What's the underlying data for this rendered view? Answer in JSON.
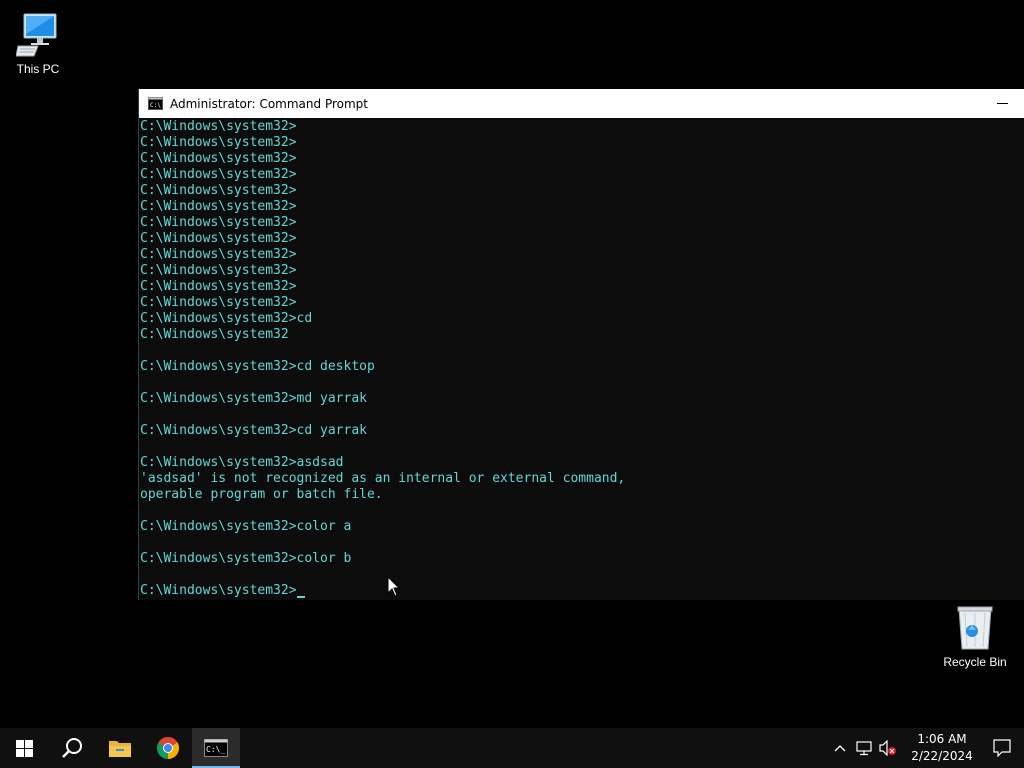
{
  "desktop": {
    "icons": [
      {
        "label": "This PC"
      },
      {
        "label": "Recycle Bin"
      }
    ]
  },
  "window": {
    "title": "Administrator: Command Prompt",
    "minimize_glyph": "—",
    "console_lines": [
      "C:\\Windows\\system32>",
      "C:\\Windows\\system32>",
      "C:\\Windows\\system32>",
      "C:\\Windows\\system32>",
      "C:\\Windows\\system32>",
      "C:\\Windows\\system32>",
      "C:\\Windows\\system32>",
      "C:\\Windows\\system32>",
      "C:\\Windows\\system32>",
      "C:\\Windows\\system32>",
      "C:\\Windows\\system32>",
      "C:\\Windows\\system32>",
      "C:\\Windows\\system32>cd",
      "C:\\Windows\\system32",
      "",
      "C:\\Windows\\system32>cd desktop",
      "",
      "C:\\Windows\\system32>md yarrak",
      "",
      "C:\\Windows\\system32>cd yarrak",
      "",
      "C:\\Windows\\system32>asdsad",
      "'asdsad' is not recognized as an internal or external command,",
      "operable program or batch file.",
      "",
      "C:\\Windows\\system32>color a",
      "",
      "C:\\Windows\\system32>color b",
      ""
    ],
    "prompt": "C:\\Windows\\system32>",
    "text_color": "#61d6d6",
    "background_color": "#0c0c0c"
  },
  "taskbar": {
    "buttons": [
      {
        "icon": "windows-start-icon"
      },
      {
        "icon": "search-icon"
      },
      {
        "icon": "file-explorer-icon"
      },
      {
        "icon": "chrome-icon"
      },
      {
        "icon": "command-prompt-icon",
        "active": true
      }
    ],
    "tray": {
      "icons": [
        "chevron-up-icon",
        "network-icon",
        "volume-muted-icon"
      ],
      "time": "1:06 AM",
      "date": "2/22/2024"
    },
    "accent_color": "#76b9ed"
  }
}
